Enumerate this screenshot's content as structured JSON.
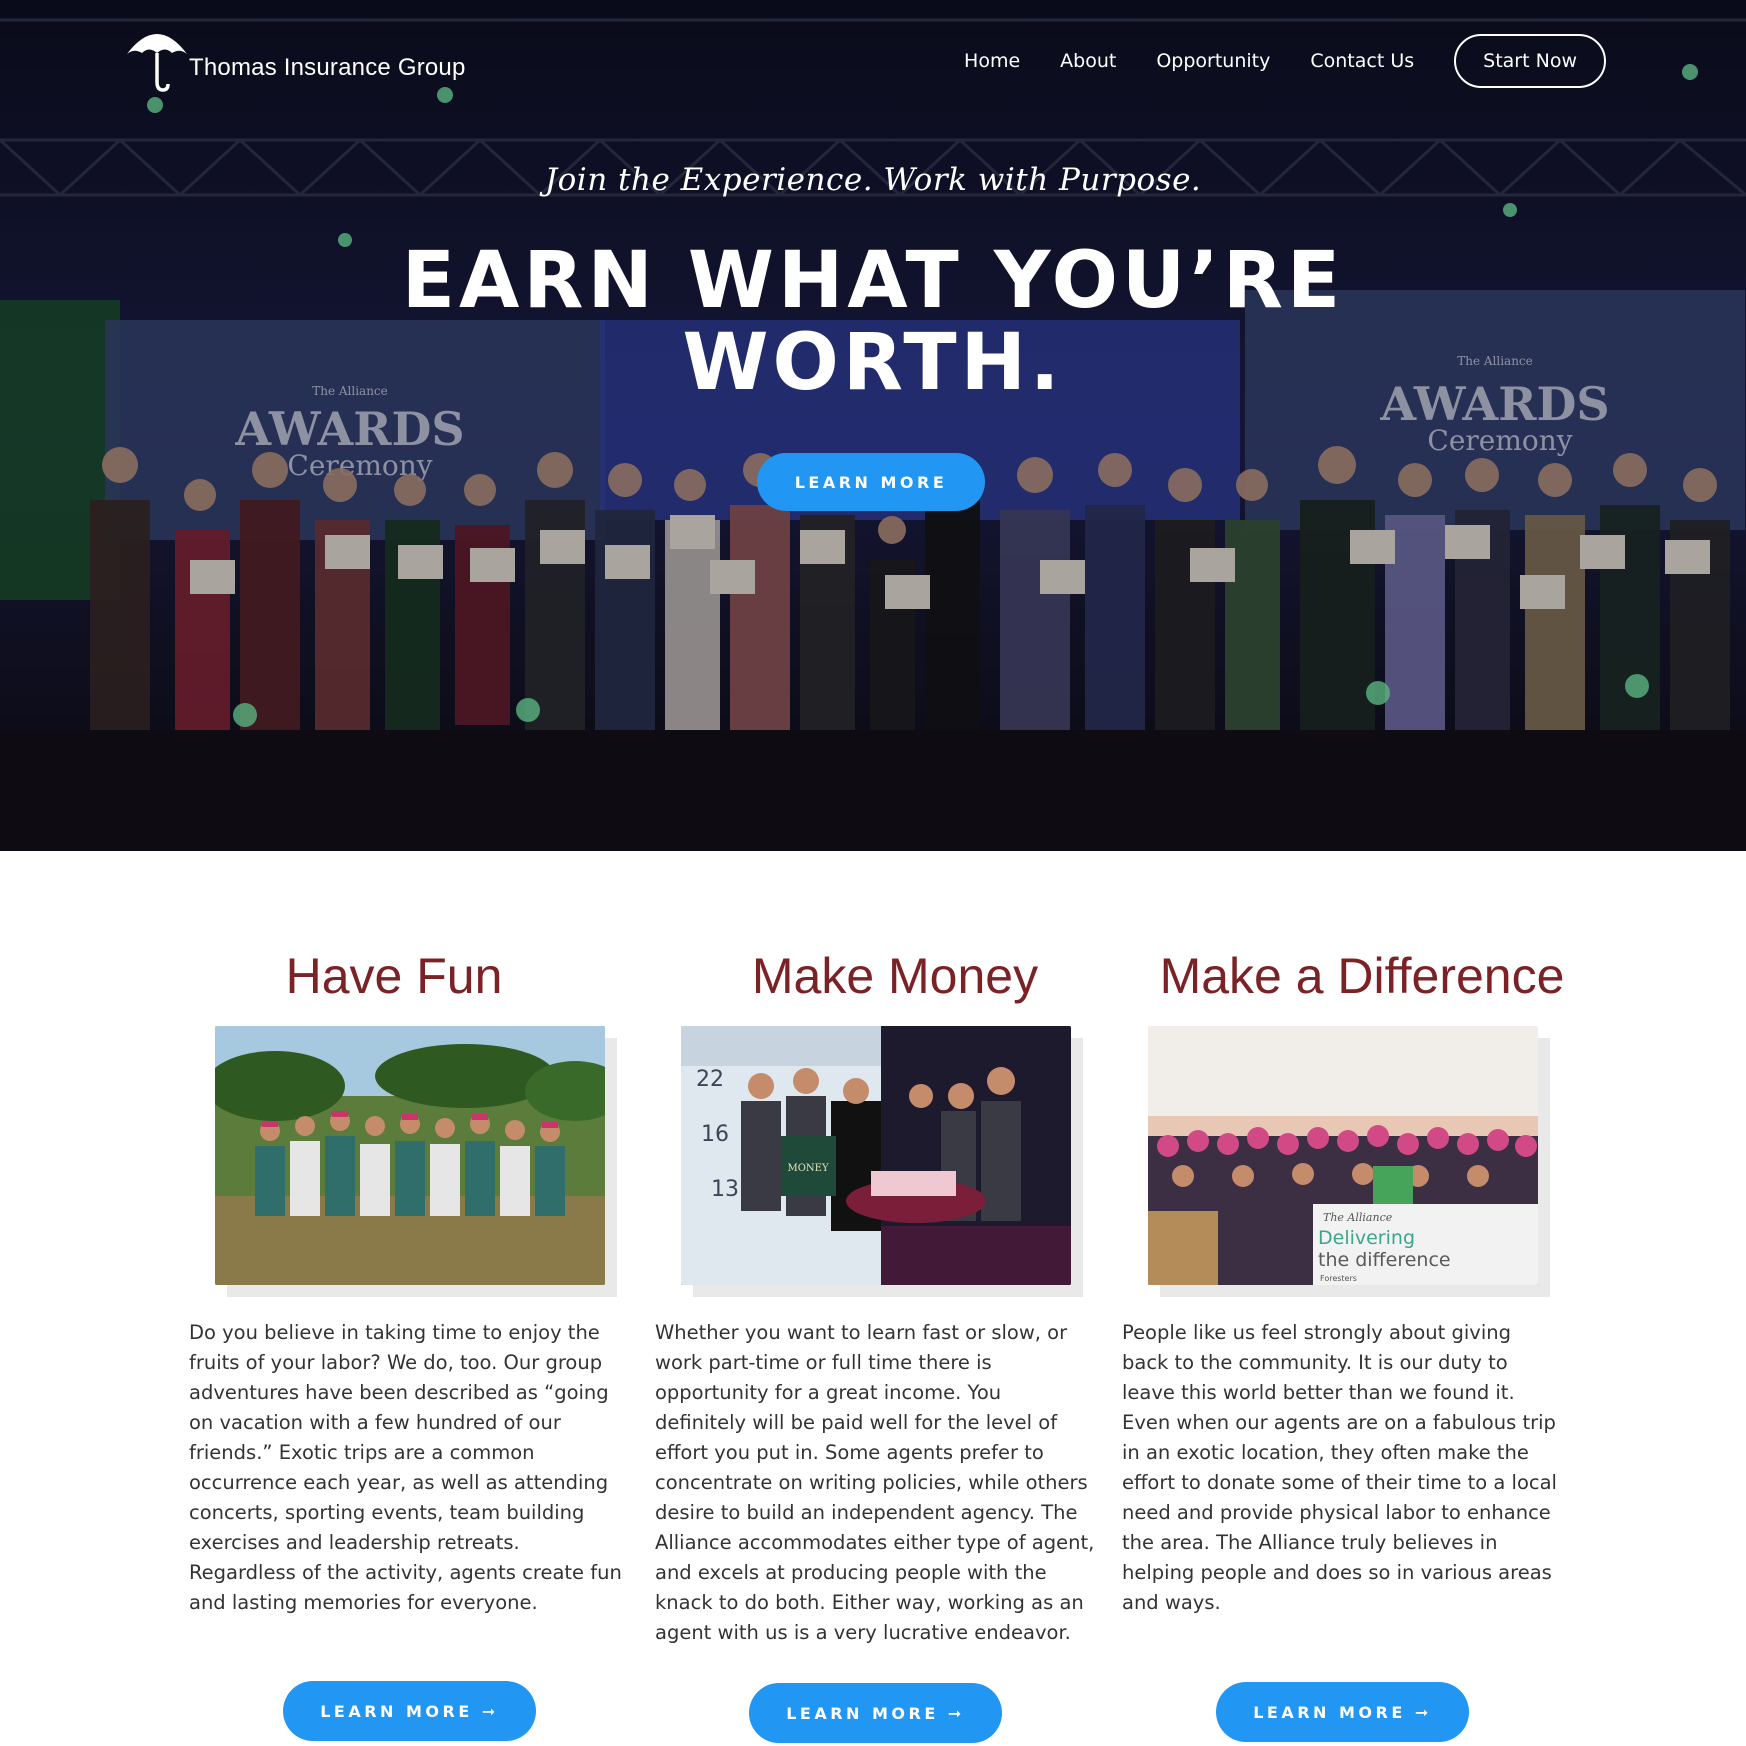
{
  "header": {
    "logo_text": "Thomas Insurance Group",
    "nav": [
      {
        "label": "Home"
      },
      {
        "label": "About"
      },
      {
        "label": "Opportunity"
      },
      {
        "label": "Contact Us"
      }
    ],
    "cta_label": "Start Now"
  },
  "hero": {
    "tagline": "Join the Experience. Work with Purpose.",
    "headline_line1": "EARN WHAT YOU’RE",
    "headline_line2": "WORTH.",
    "button_label": "LEARN MORE",
    "screen_left_text": "AWARDS",
    "screen_left_sub": "Ceremony",
    "screen_left_small": "The Alliance",
    "screen_right_text": "AWARDS",
    "screen_right_sub": "Ceremony",
    "screen_right_small": "The Alliance"
  },
  "features": [
    {
      "title": "Have Fun",
      "text": "Do you believe in taking time to enjoy the fruits of your labor? We do, too. Our group adventures have been described as “going on vacation with a few hundred of our friends.” Exotic trips are a common occurrence each year, as well as attending concerts, sporting events, team building exercises and leadership retreats. Regardless of the activity, agents create fun and lasting memories for everyone.",
      "button_label": "LEARN MORE ➞"
    },
    {
      "title": "Make Money",
      "text": "Whether you want to learn fast or slow, or work part-time or full time there is opportunity for a great income. You definitely will be paid well for the level of effort you put in. Some agents prefer to concentrate on writing policies, while others desire to build an independent agency. The Alliance accommodates either type of agent, and excels at producing people with the knack to do both. Either way, working as an agent with us is a very lucrative endeavor.",
      "button_label": "LEARN MORE ➞",
      "photo_numbers": [
        "22",
        "16",
        "13"
      ],
      "photo_bag_text": "MONEY"
    },
    {
      "title": "Make a Difference",
      "text": "People like us feel strongly about giving back to the community. It is our duty to leave this world better than we found it. Even when our agents are on a fabulous trip in an exotic location, they often make the effort to donate some of their time to a local need and provide physical labor to enhance the area. The Alliance truly believes in helping people and does so in various areas and ways.",
      "button_label": "LEARN MORE ➞",
      "banner_small": "The Alliance",
      "banner_line1": "Delivering",
      "banner_line2": "the difference",
      "banner_brand": "Foresters"
    }
  ],
  "colors": {
    "accent_blue": "#2196f3",
    "heading_maroon": "#7b2226",
    "body_text": "#333333"
  }
}
